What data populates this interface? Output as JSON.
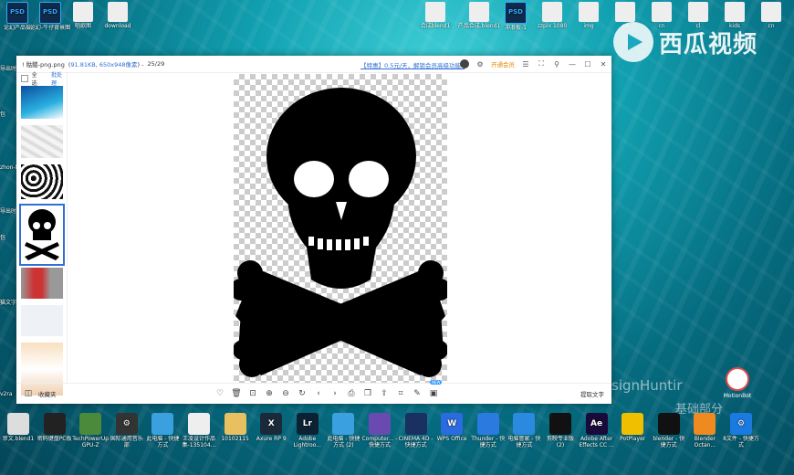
{
  "desktop": {
    "top_icons": [
      {
        "label": "论幻产品摄",
        "kind": "PSD"
      },
      {
        "label": "论幻-牛仔背景图",
        "kind": "PSD"
      },
      {
        "label": "唱歌图",
        "kind": "file"
      },
      {
        "label": "download",
        "kind": "file"
      },
      {
        "label": "合成blend1",
        "kind": "file"
      },
      {
        "label": "产品合成.blend1",
        "kind": "file"
      },
      {
        "label": "冲浪板-1",
        "kind": "PSD"
      },
      {
        "label": "zzpix 1080",
        "kind": "file"
      },
      {
        "label": "img",
        "kind": "file"
      },
      {
        "label": "cn",
        "kind": "file"
      },
      {
        "label": "cn",
        "kind": "file"
      },
      {
        "label": "cl",
        "kind": "file"
      },
      {
        "label": "kids",
        "kind": "file"
      },
      {
        "label": "cn",
        "kind": "file"
      }
    ],
    "left_labels": [
      "导出时",
      "包",
      "zhon-Mac 版",
      "导出时",
      "包",
      "猫文字",
      "v2ra"
    ],
    "watermark": {
      "brand": "西瓜视频"
    },
    "overlay_text": {
      "designer": "signHuntir",
      "course": "基础部分"
    },
    "mobot_label": "MotionBot"
  },
  "viewer": {
    "title": "! 骷髅-png.png",
    "file_size": "91.81KB",
    "dimensions": "650x948像素",
    "counter": "25/29",
    "promo": "【特惠】0.5元/天，解锁会员高级功能»",
    "open_vip": "开通会员",
    "select_all": "全选",
    "batch": "批处理",
    "collection": "收藏夹",
    "extract_text": "提取文字",
    "new_badge": "NEW",
    "thumbnails": [
      "wave",
      "marble",
      "pattern",
      "skull",
      "bottles",
      "placeholder",
      "collage"
    ]
  },
  "taskbar": [
    {
      "label": "审文.blend1",
      "color": "#dddddd",
      "glyph": ""
    },
    {
      "label": "密码键盘PC板",
      "color": "#222222",
      "glyph": ""
    },
    {
      "label": "TechPowerUp GPU-Z",
      "color": "#4a8a3a",
      "glyph": ""
    },
    {
      "label": "国际通用音乐部",
      "color": "#333333",
      "glyph": "⚙"
    },
    {
      "label": "此电脑 - 快捷方式",
      "color": "#3aa0e0",
      "glyph": ""
    },
    {
      "label": "王凌设计作品集-135104...",
      "color": "#eeeeee",
      "glyph": ""
    },
    {
      "label": "10102115",
      "color": "#e8c060",
      "glyph": ""
    },
    {
      "label": "Axure RP 9",
      "color": "#1a2a3a",
      "glyph": "X"
    },
    {
      "label": "Adobe Lightroo...",
      "color": "#0c2233",
      "glyph": "Lr"
    },
    {
      "label": "此电脑 - 快捷方式 (2)",
      "color": "#3aa0e0",
      "glyph": ""
    },
    {
      "label": "Computer... - 快捷方式",
      "color": "#6a4ab0",
      "glyph": ""
    },
    {
      "label": "CINEMA 4D - 快捷方式",
      "color": "#1a3060",
      "glyph": ""
    },
    {
      "label": "WPS Office",
      "color": "#2b6be0",
      "glyph": "W"
    },
    {
      "label": "Thunder - 快捷方式",
      "color": "#2a7ae0",
      "glyph": ""
    },
    {
      "label": "电脑管家 - 快捷方式",
      "color": "#2a8ae0",
      "glyph": ""
    },
    {
      "label": "剪映专业版 (2)",
      "color": "#111111",
      "glyph": ""
    },
    {
      "label": "Adobe After Effects CC ...",
      "color": "#1a0a3a",
      "glyph": "Ae"
    },
    {
      "label": "PotPlayer",
      "color": "#f0c000",
      "glyph": ""
    },
    {
      "label": "blender - 快捷方式",
      "color": "#111111",
      "glyph": ""
    },
    {
      "label": "Blender Octan...",
      "color": "#ee8a20",
      "glyph": ""
    },
    {
      "label": "8文件 - 快捷方式",
      "color": "#1a7ae0",
      "glyph": "⚙"
    }
  ],
  "colors": {
    "accent": "#2f6fd6",
    "vip": "#e58a00"
  }
}
